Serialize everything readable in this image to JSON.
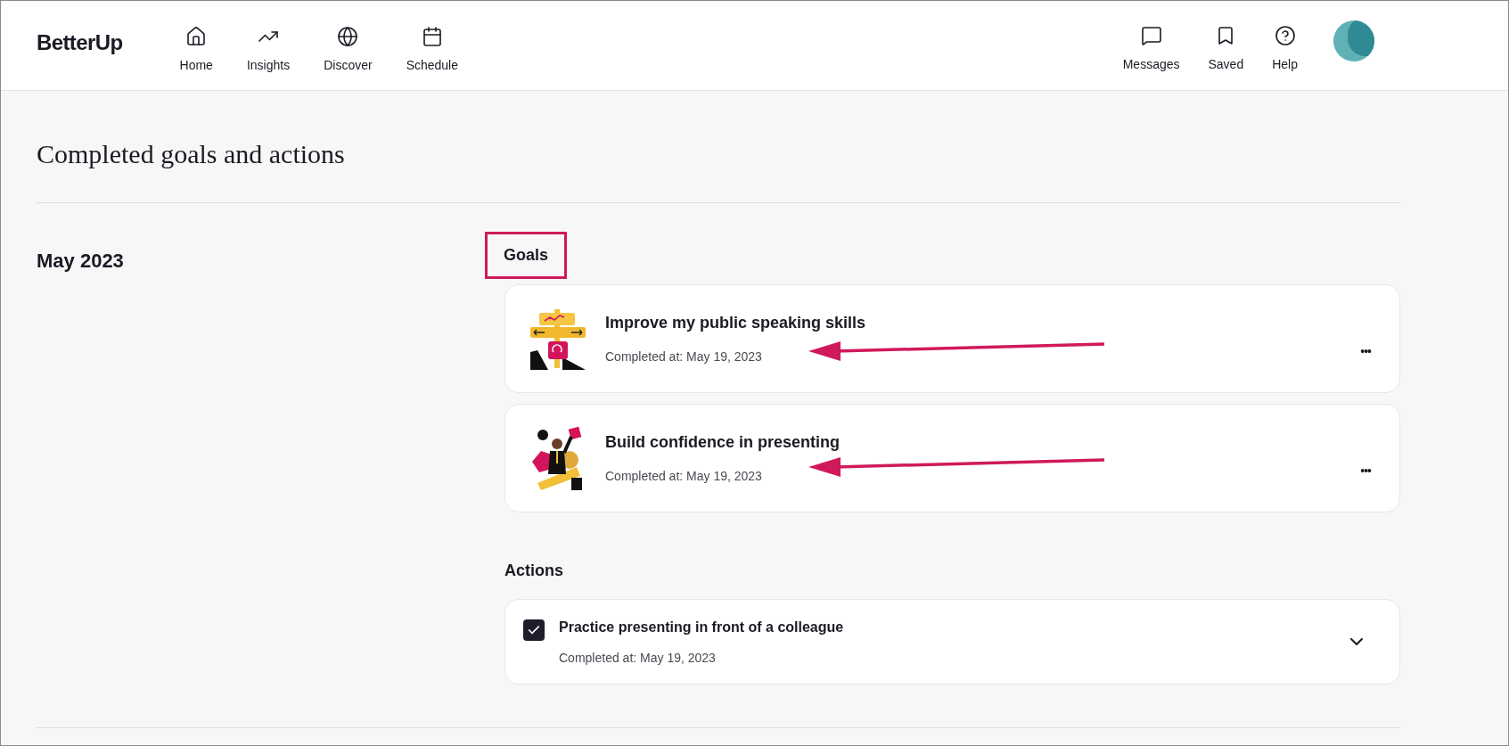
{
  "header": {
    "logo": "BetterUp",
    "nav": [
      {
        "label": "Home",
        "kind": "home"
      },
      {
        "label": "Insights",
        "kind": "insights"
      },
      {
        "label": "Discover",
        "kind": "discover"
      },
      {
        "label": "Schedule",
        "kind": "schedule"
      }
    ],
    "right_nav": [
      {
        "label": "Messages",
        "kind": "messages"
      },
      {
        "label": "Saved",
        "kind": "saved"
      },
      {
        "label": "Help",
        "kind": "help"
      }
    ]
  },
  "page_title": "Completed goals and actions",
  "month": "May 2023",
  "goals_heading": "Goals",
  "goals": [
    {
      "title": "Improve my public speaking skills",
      "completed": "Completed at: May 19, 2023",
      "kind": "signpost",
      "more": "•••"
    },
    {
      "title": "Build confidence in presenting",
      "completed": "Completed at: May 19, 2023",
      "kind": "presenter",
      "more": "•••"
    }
  ],
  "actions_heading": "Actions",
  "actions": [
    {
      "title": "Practice presenting in front of a colleague",
      "completed": "Completed at: May 19, 2023",
      "checked": true,
      "expanded": false
    }
  ]
}
